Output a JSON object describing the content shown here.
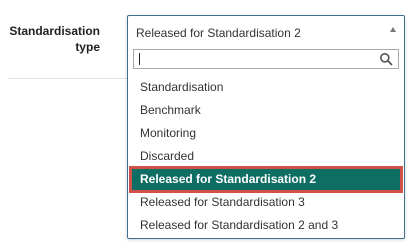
{
  "form": {
    "label_line1": "Standardisation",
    "label_line2": "type"
  },
  "dropdown": {
    "selected_value": "Released for Standardisation 2",
    "search_value": "",
    "options": [
      "Standardisation",
      "Benchmark",
      "Monitoring",
      "Discarded",
      "Released for Standardisation 2",
      "Released for Standardisation 3",
      "Released for Standardisation 2 and 3"
    ],
    "selected_index": 4
  },
  "colors": {
    "accent": "#0f6e63",
    "highlight_border": "#d0504a",
    "select_border": "#3f6f8c"
  },
  "icons": {
    "dropdown_caret": "caret-up-icon",
    "search": "search-icon"
  }
}
